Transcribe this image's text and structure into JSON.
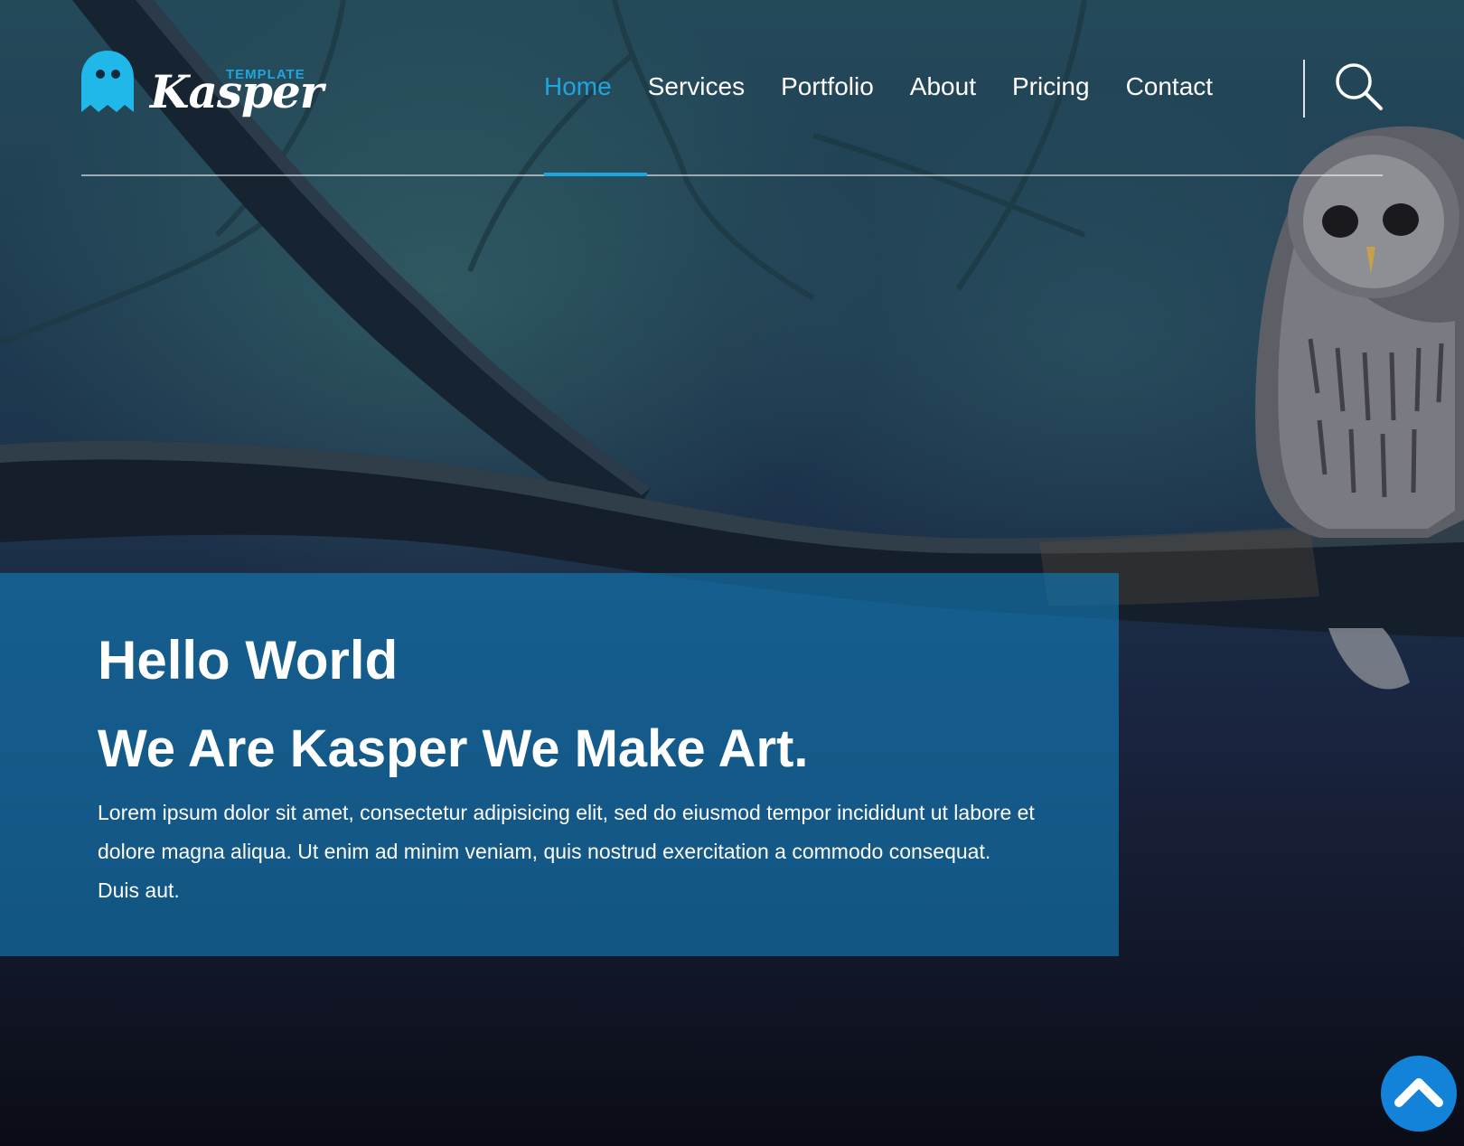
{
  "brand": {
    "name": "Kasper",
    "tagline": "TEMPLATE",
    "accent_color": "#1fa6df"
  },
  "nav": {
    "items": [
      {
        "label": "Home",
        "active": true
      },
      {
        "label": "Services",
        "active": false
      },
      {
        "label": "Portfolio",
        "active": false
      },
      {
        "label": "About",
        "active": false
      },
      {
        "label": "Pricing",
        "active": false
      },
      {
        "label": "Contact",
        "active": false
      }
    ],
    "search_icon": "search-icon"
  },
  "intro": {
    "title": "Hello World",
    "subtitle": "We Are Kasper We Make Art.",
    "body": "Lorem ipsum dolor sit amet, consectetur adipisicing elit, sed do eiusmod tempor incididunt ut labore et dolore magna aliqua. Ut enim ad minim veniam, quis nostrud exercitation a commodo consequat. Duis aut.",
    "background_color": "#117cba"
  },
  "scroll_top": {
    "icon": "chevron-up-icon",
    "color": "#1283d8"
  },
  "background": {
    "image": "owl-on-branch-photo"
  }
}
